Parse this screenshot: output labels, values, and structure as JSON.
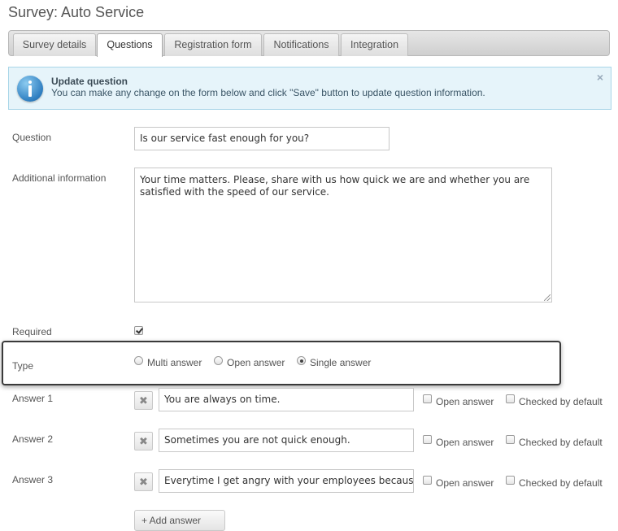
{
  "page": {
    "title": "Survey: Auto Service"
  },
  "tabs": [
    {
      "label": "Survey details"
    },
    {
      "label": "Questions"
    },
    {
      "label": "Registration form"
    },
    {
      "label": "Notifications"
    },
    {
      "label": "Integration"
    }
  ],
  "active_tab": "Questions",
  "alert": {
    "title": "Update question",
    "message": "You can make any change on the form below and click \"Save\" button to update question information.",
    "close_glyph": "×",
    "icon": "info-icon"
  },
  "form": {
    "question_label": "Question",
    "question_value": "Is our service fast enough for you?",
    "additional_label": "Additional information",
    "additional_value": "Your time matters. Please, share with us how quick we are and whether you are satisfied with the speed of our service.",
    "required_label": "Required",
    "required_checked": true,
    "type_label": "Type",
    "type_options": [
      {
        "label": "Multi answer",
        "selected": false
      },
      {
        "label": "Open answer",
        "selected": false
      },
      {
        "label": "Single answer",
        "selected": true
      }
    ],
    "answers": [
      {
        "label": "Answer 1",
        "value": "You are always on time.",
        "open_label": "Open answer",
        "checked_label": "Checked by default"
      },
      {
        "label": "Answer 2",
        "value": "Sometimes you are not quick enough.",
        "open_label": "Open answer",
        "checked_label": "Checked by default"
      },
      {
        "label": "Answer 3",
        "value": "Everytime I get angry with your employees because",
        "open_label": "Open answer",
        "checked_label": "Checked by default"
      }
    ],
    "delete_glyph": "✖",
    "add_answer_label": "+ Add answer"
  },
  "colors": {
    "alert_bg": "#e6f4fa",
    "alert_border": "#a9d6e8",
    "highlight_border": "#3a3a3a"
  }
}
